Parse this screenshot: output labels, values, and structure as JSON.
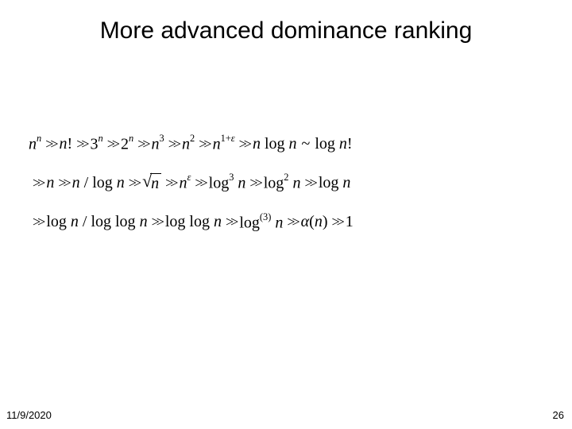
{
  "title": "More advanced dominance ranking",
  "footer": {
    "date": "11/9/2020",
    "page": "26"
  },
  "sym": {
    "n": "n",
    "fact": "!",
    "three": "3",
    "two": "2",
    "one": "1",
    "plus": "+",
    "eps": "ε",
    "log": "log",
    "loglog": "log log",
    "tilde": "~",
    "slash": "/",
    "alpha": "α",
    "lp": "(",
    "rp": ")",
    "paren3": "(3)"
  }
}
